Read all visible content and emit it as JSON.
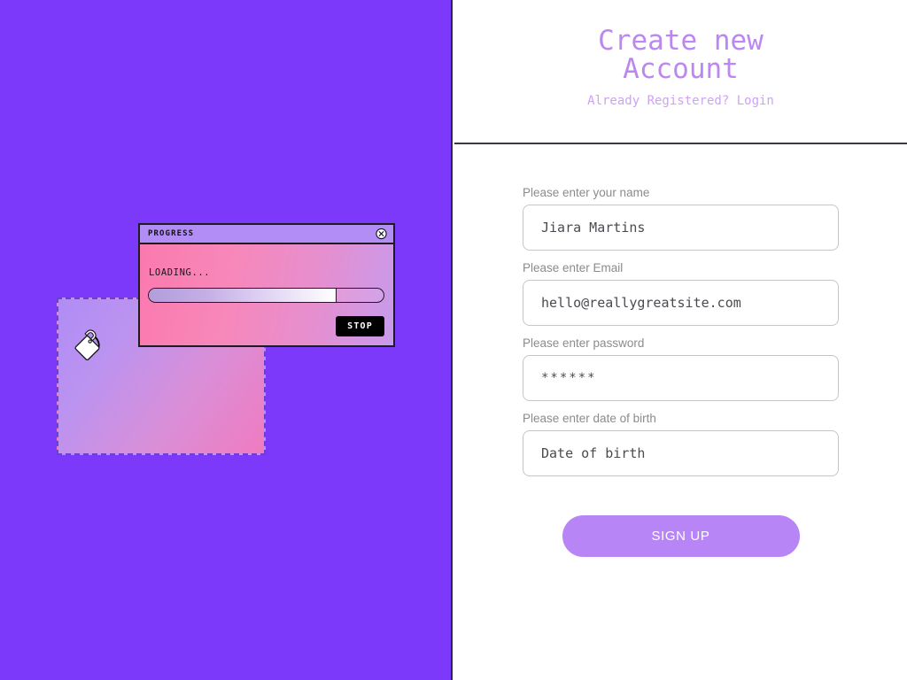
{
  "left_panel": {
    "background_color": "#7D39FA",
    "decor": {
      "dashed_square_gradient_from": "#b08cf5",
      "dashed_square_gradient_to": "#f07bc0",
      "tag_icon": "price-tag-icon"
    },
    "progress_window": {
      "title": "PROGRESS",
      "close_icon": "close-circle-icon",
      "status_text": "LOADING...",
      "progress_percent": 80,
      "stop_label": "STOP",
      "titlebar_color": "#b18df5",
      "body_gradient_from": "#fa79ae",
      "body_gradient_to": "#c79bec"
    }
  },
  "right_panel": {
    "header": {
      "title_line1": "Create new",
      "title_line2": "Account",
      "subtitle": "Already Registered? Login",
      "title_color": "#bc87f0",
      "subtitle_color": "#cda3f2"
    },
    "form": {
      "fields": [
        {
          "label": "Please enter your name",
          "value": "Jiara Martins",
          "name": "name"
        },
        {
          "label": "Please enter Email",
          "value": "hello@reallygreatsite.com",
          "name": "email"
        },
        {
          "label": "Please enter password",
          "value": "******",
          "name": "password"
        },
        {
          "label": "Please enter date of birth",
          "value": "Date of birth",
          "name": "dob"
        }
      ],
      "submit_label": "SIGN UP",
      "submit_color": "#b785f5"
    }
  }
}
